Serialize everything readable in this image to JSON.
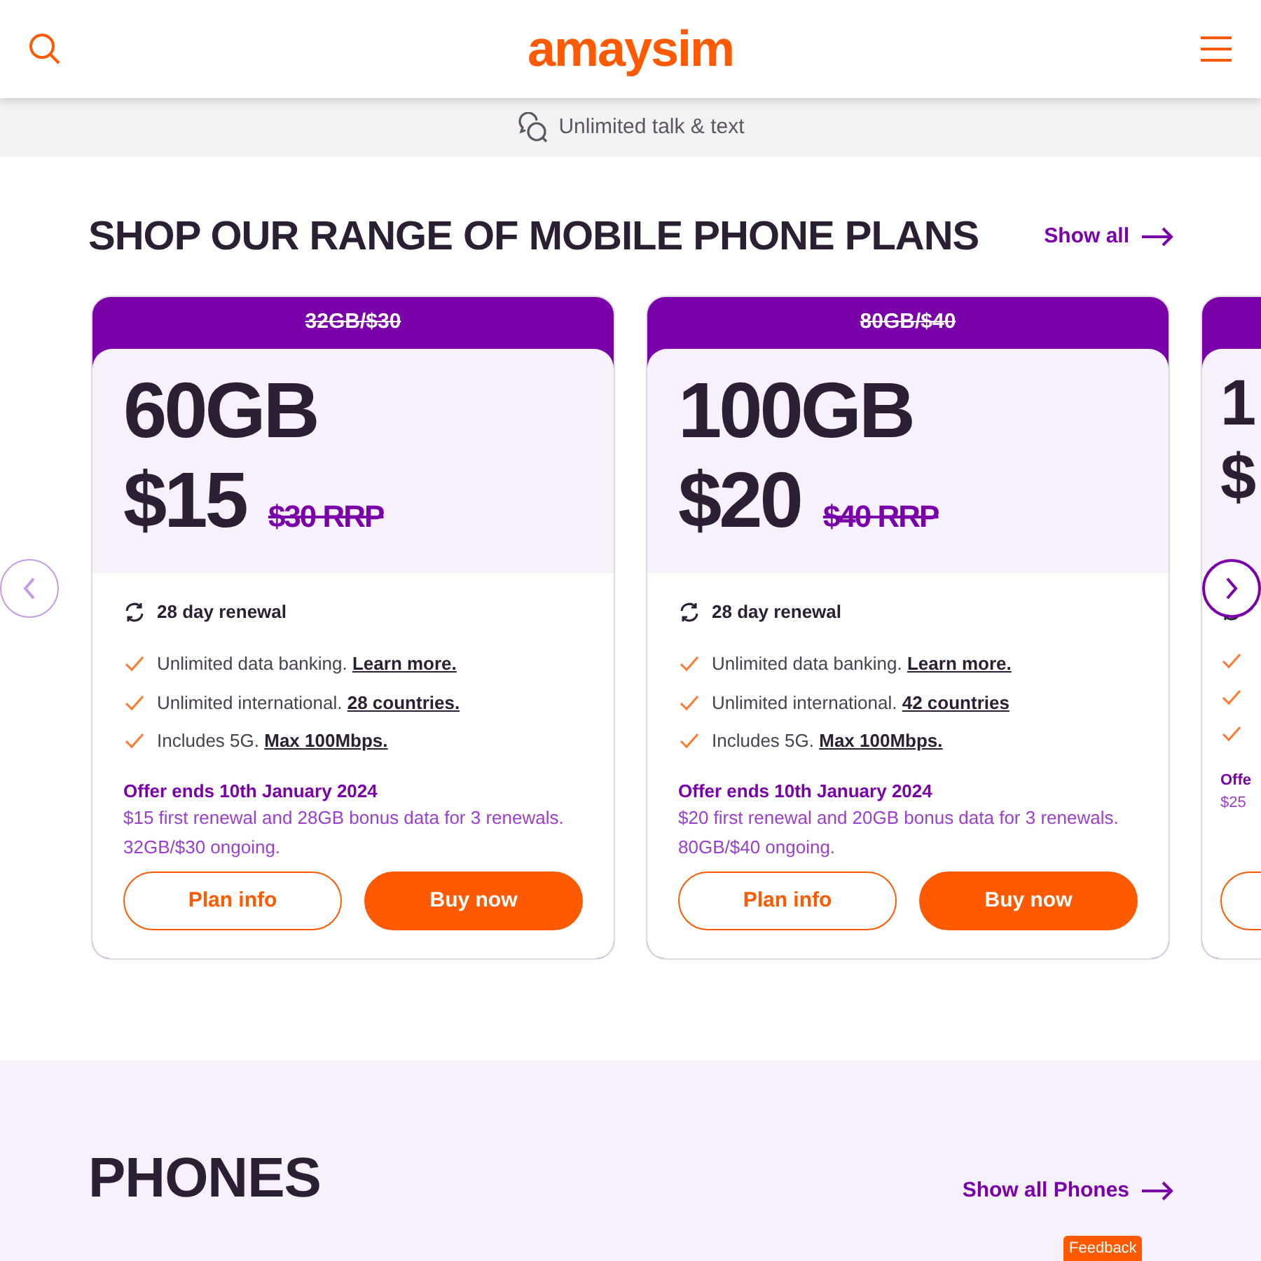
{
  "header": {
    "logo": "amaysim"
  },
  "banner": {
    "text": "Unlimited talk & text"
  },
  "plans_section": {
    "title": "SHOP OUR RANGE OF MOBILE PHONE PLANS",
    "link": "Show all",
    "cards": [
      {
        "old_plan": "32GB/$30",
        "data": "60GB",
        "price": "$15",
        "rrp": "$30 RRP",
        "features": [
          {
            "kind": "renewal",
            "text": "28 day renewal"
          },
          {
            "kind": "check",
            "text": "Unlimited data banking.",
            "link": "Learn more."
          },
          {
            "kind": "check",
            "text": "Unlimited international.",
            "link": "28 countries."
          },
          {
            "kind": "check",
            "text": "Includes 5G.",
            "link": "Max 100Mbps."
          }
        ],
        "offer_title": "Offer ends 10th January 2024",
        "offer_text": "$15 first renewal and 28GB bonus data for 3 renewals. 32GB/$30 ongoing.",
        "buttons": [
          {
            "kind": "outline",
            "label": "Plan info"
          },
          {
            "kind": "solid",
            "label": "Buy now"
          }
        ]
      },
      {
        "old_plan": "80GB/$40",
        "data": "100GB",
        "price": "$20",
        "rrp": "$40 RRP",
        "features": [
          {
            "kind": "renewal",
            "text": "28 day renewal"
          },
          {
            "kind": "check",
            "text": "Unlimited data banking.",
            "link": "Learn more."
          },
          {
            "kind": "check",
            "text": "Unlimited international.",
            "link": "42 countries"
          },
          {
            "kind": "check",
            "text": "Includes 5G.",
            "link": "Max 100Mbps."
          }
        ],
        "offer_title": "Offer ends 10th January 2024",
        "offer_text": "$20 first renewal and 20GB bonus data for 3 renewals. 80GB/$40 ongoing.",
        "buttons": [
          {
            "kind": "outline",
            "label": "Plan info"
          },
          {
            "kind": "solid",
            "label": "Buy now"
          }
        ]
      },
      {
        "data": "1",
        "price": "$",
        "features": [
          {
            "kind": "renewal"
          },
          {
            "kind": "check"
          },
          {
            "kind": "check"
          },
          {
            "kind": "check"
          }
        ],
        "offer_title": "Offe",
        "offer_text": "$25",
        "buttons": [
          {
            "kind": "outline"
          }
        ]
      }
    ]
  },
  "phones_section": {
    "title": "PHONES",
    "link": "Show all Phones"
  },
  "feedback": {
    "label": "Feedback"
  }
}
